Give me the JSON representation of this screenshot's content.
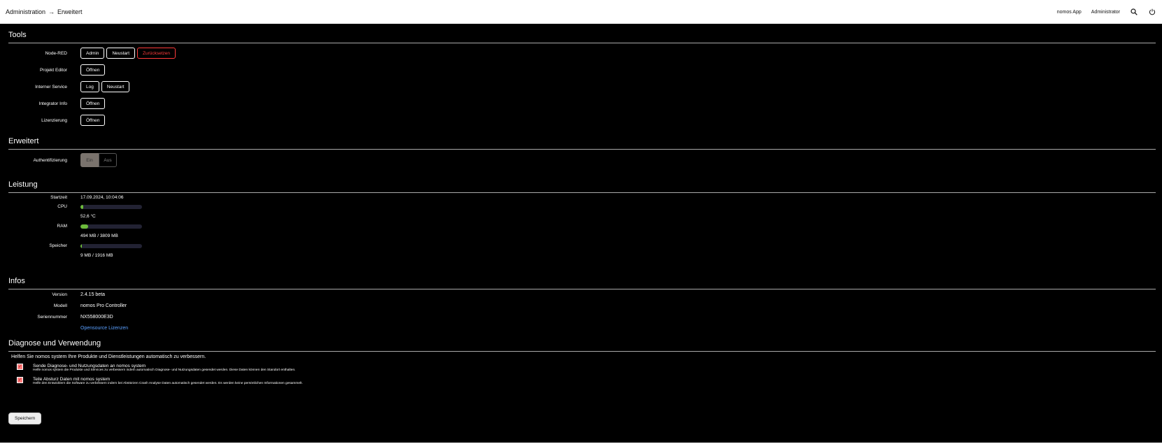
{
  "breadcrumb": {
    "parent": "Administration",
    "separator": "→",
    "current": "Erweitert"
  },
  "topbar": {
    "app_link": "nomos App",
    "user": "Administrator"
  },
  "tools": {
    "title": "Tools",
    "rows": [
      {
        "label": "Node-RED",
        "buttons": [
          "Admin",
          "Neustart",
          "Zurücksetzen"
        ]
      },
      {
        "label": "Projekt Editor",
        "buttons": [
          "Öffnen"
        ]
      },
      {
        "label": "Interner Service",
        "buttons": [
          "Log",
          "Neustart"
        ]
      },
      {
        "label": "Integrator Info",
        "buttons": [
          "Öffnen"
        ]
      },
      {
        "label": "Lizenzierung",
        "buttons": [
          "Öffnen"
        ]
      }
    ]
  },
  "advanced": {
    "title": "Erweitert",
    "auth_label": "Authentifizierung",
    "on": "Ein",
    "off": "Aus",
    "selected": "Ein"
  },
  "performance": {
    "title": "Leistung",
    "start_label": "Startzeit",
    "start_value": "17.09.2024, 10:04:06",
    "cpu_label": "CPU",
    "cpu_value": "52,6 °C",
    "cpu_fraction": 0.05,
    "ram_label": "RAM",
    "ram_value": "494 MB / 3809 MB",
    "ram_fraction": 0.13,
    "storage_label": "Speicher",
    "storage_value": "9 MB / 1916 MB",
    "storage_fraction": 0.01
  },
  "infos": {
    "title": "Infos",
    "version_label": "Version",
    "version_value": "2.4.15 beta",
    "model_label": "Modell",
    "model_value": "nomos Pro Controller",
    "serial_label": "Seriennummer",
    "serial_value": "NX558000E3D",
    "opensource_link": "Opensource Lizenzen"
  },
  "diagnose": {
    "title": "Diagnose und Verwendung",
    "intro": "Helfen Sie nomos system Ihre Produkte und Dienstleistungen automatisch zu verbessern.",
    "items": [
      {
        "title": "Sende Diagnose- und Nutzungsdaten an nomos system",
        "desc": "Helfe nomos system die Produkte und Services zu verbessern indem automatisch Diagnose- und Nutzungsdaten gesendet werden. Diese Daten können den Standort enthalten.",
        "checked": true
      },
      {
        "title": "Teile Absturz Daten mit nomos system",
        "desc": "Helfe den Entwicklern die Software zu verbessern indem bei Abstürzen Crash Analyse Daten automatisch gesendet werden. Es werden keine persönlichen Informationen gesammelt.",
        "checked": true
      }
    ],
    "save": "Speichern"
  },
  "colors": {
    "danger": "#ff3b3b",
    "bar_fill": "#6dbb3c",
    "link": "#5aa0ff"
  },
  "icons": {
    "search": "search-icon",
    "power": "power-icon"
  }
}
